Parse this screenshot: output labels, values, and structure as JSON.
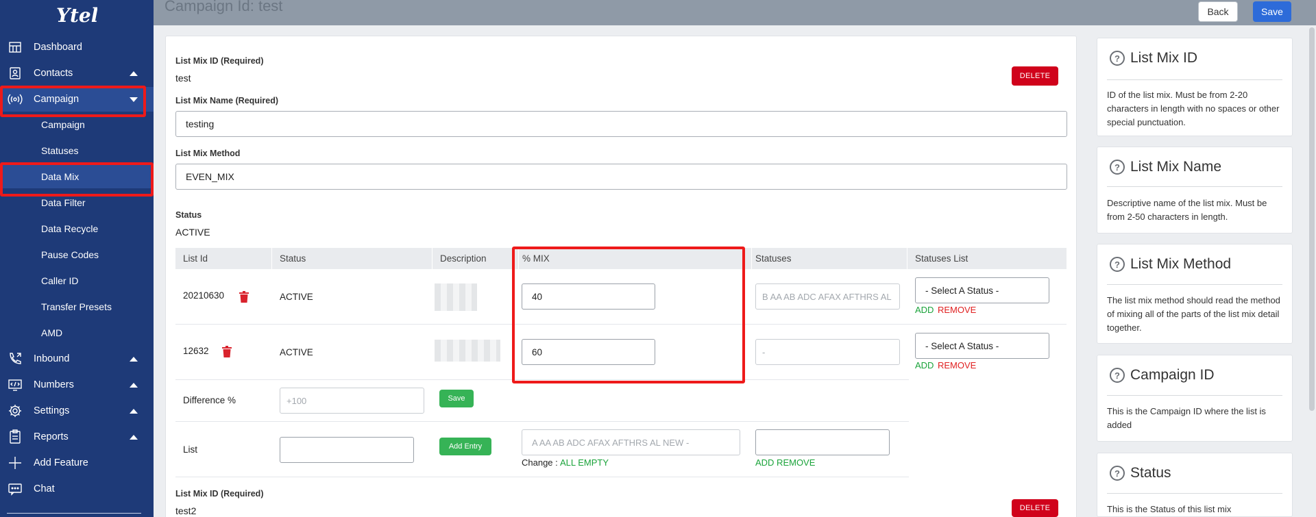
{
  "sidebar": {
    "logo": "Ytel",
    "items": [
      {
        "label": "Dashboard",
        "icon": "dashboard-icon"
      },
      {
        "label": "Contacts",
        "icon": "contacts-icon"
      },
      {
        "label": "Campaign",
        "icon": "broadcast-icon"
      },
      {
        "label": "Inbound",
        "icon": "phone-icon"
      },
      {
        "label": "Numbers",
        "icon": "numbers-icon"
      },
      {
        "label": "Settings",
        "icon": "gear-icon"
      },
      {
        "label": "Reports",
        "icon": "clipboard-icon"
      },
      {
        "label": "Add Feature",
        "icon": "plus-icon"
      },
      {
        "label": "Chat",
        "icon": "chat-icon"
      }
    ],
    "campaign_sub": [
      "Campaign",
      "Statuses",
      "Data Mix",
      "Data Filter",
      "Data Recycle",
      "Pause Codes",
      "Caller ID",
      "Transfer Presets",
      "AMD"
    ]
  },
  "header": {
    "title": "Campaign Id: test",
    "back_label": "Back",
    "save_label": "Save"
  },
  "form": {
    "mix_id_label": "List Mix ID (Required)",
    "mix_id_value": "test",
    "delete_label": "DELETE",
    "mix_name_label": "List Mix Name (Required)",
    "mix_name_value": "testing",
    "mix_method_label": "List Mix Method",
    "mix_method_value": "EVEN_MIX",
    "status_label": "Status",
    "status_value": "ACTIVE"
  },
  "table": {
    "headers": [
      "List Id",
      "Status",
      "Description",
      "% MIX",
      "Statuses",
      "Statuses List"
    ],
    "rows": [
      {
        "list_id": "20210630",
        "status": "ACTIVE",
        "mix": "40",
        "statuses": "B AA AB ADC AFAX AFTHRS AL",
        "select": "- Select A Status -",
        "add": "ADD",
        "remove": "REMOVE"
      },
      {
        "list_id": "12632",
        "status": "ACTIVE",
        "mix": "60",
        "statuses": "-",
        "select": "- Select A Status -",
        "add": "ADD",
        "remove": "REMOVE"
      }
    ],
    "difference_label": "Difference %",
    "difference_placeholder": "+100",
    "save_label": "Save",
    "list_label": "List",
    "add_entry_label": "Add Entry",
    "list_statuses_placeholder": "A AA AB ADC AFAX AFTHRS AL NEW -",
    "change_label": "Change :",
    "change_value": "ALL EMPTY",
    "add_remove": "ADD REMOVE"
  },
  "form2": {
    "mix_id_label": "List Mix ID (Required)",
    "mix_id_value": "test2",
    "delete_label": "DELETE"
  },
  "help": [
    {
      "title": "List Mix ID",
      "body": "ID of the list mix. Must be from 2-20 characters in length with no spaces or other special punctuation."
    },
    {
      "title": "List Mix Name",
      "body": "Descriptive name of the list mix. Must be from 2-50 characters in length."
    },
    {
      "title": "List Mix Method",
      "body": "The list mix method should read the method of mixing all of the parts of the list mix detail together."
    },
    {
      "title": "Campaign ID",
      "body": "This is the Campaign ID where the list is added"
    },
    {
      "title": "Status",
      "body": "This is the Status of this list mix"
    }
  ],
  "colors": {
    "sidebar": "#1e3a78",
    "primary": "#2d6bd9",
    "danger": "#d0021b",
    "success": "#36b356",
    "highlight": "#ee1a1a"
  }
}
